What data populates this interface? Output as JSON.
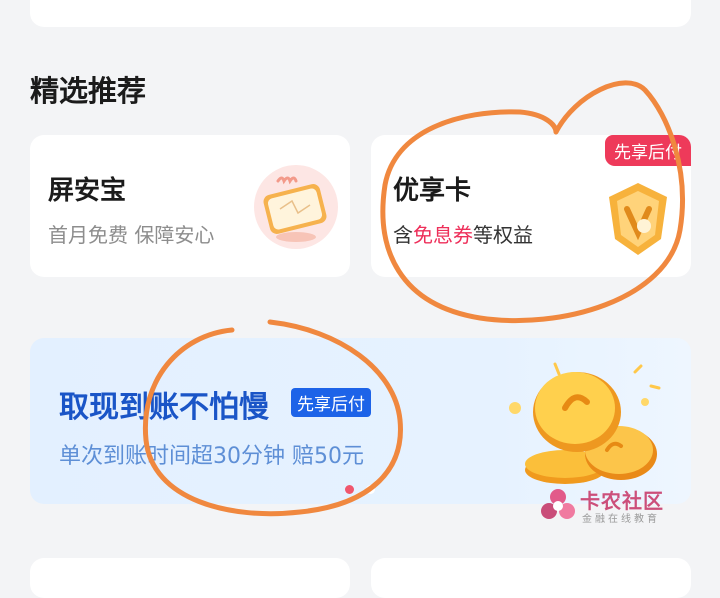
{
  "section": {
    "title": "精选推荐"
  },
  "products": [
    {
      "title": "屏安宝",
      "subtitle": "首月免费 保障安心",
      "icon": "screen-protect-icon"
    },
    {
      "title": "优享卡",
      "subtitle_prefix": "含",
      "subtitle_highlight": "免息券",
      "subtitle_suffix": "等权益",
      "tag": "先享后付",
      "icon": "vip-card-icon"
    }
  ],
  "banner": {
    "title": "取现到账不怕慢",
    "tag": "先享后付",
    "subtitle": "单次到账时间超30分钟 赔50元",
    "dots": 2,
    "active_dot": 0
  },
  "watermark": {
    "title": "卡农社区",
    "subtitle": "金融在线教育"
  },
  "colors": {
    "accent_red": "#ee3a5a",
    "banner_blue": "#1a55c7",
    "annotation": "#f0883f"
  }
}
